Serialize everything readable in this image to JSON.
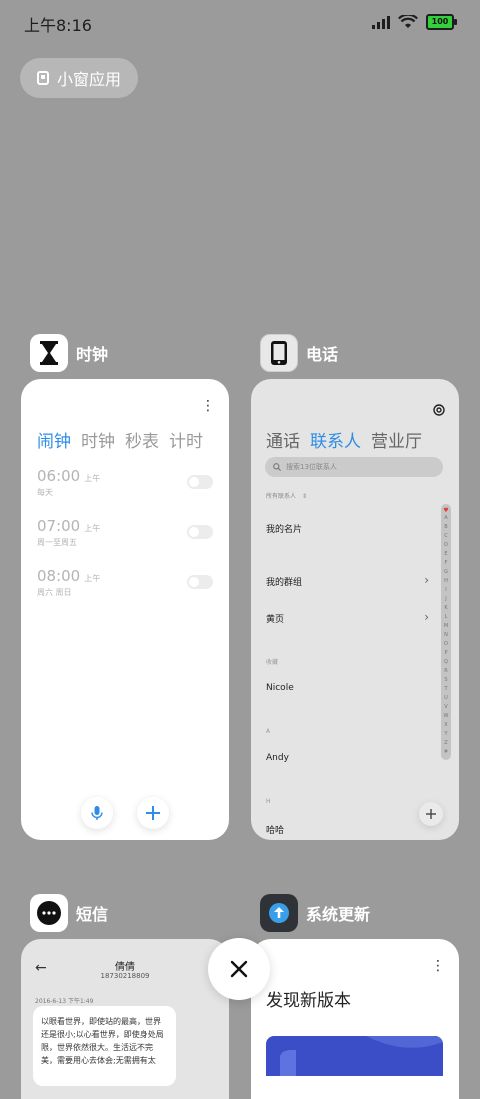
{
  "status_bar": {
    "time": "上午8:16",
    "battery": "100"
  },
  "floating_window_button": {
    "label": "小窗应用"
  },
  "apps": {
    "clock": {
      "name": "时钟",
      "tabs": [
        "闹钟",
        "时钟",
        "秒表",
        "计时"
      ],
      "alarms": [
        {
          "time": "06:00",
          "ampm": "上午",
          "repeat": "每天"
        },
        {
          "time": "07:00",
          "ampm": "上午",
          "repeat": "周一至周五"
        },
        {
          "time": "08:00",
          "ampm": "上午",
          "repeat": "周六 周日"
        }
      ]
    },
    "phone": {
      "name": "电话",
      "tabs": [
        "通话",
        "联系人",
        "营业厅"
      ],
      "search_placeholder": "搜索13位联系人",
      "filter_label": "所有联系人",
      "my_card": "我的名片",
      "my_groups": "我的群组",
      "yellow_pages": "黄页",
      "favorites_label": "收藏",
      "contacts": [
        {
          "section": "",
          "name": "Nicole"
        },
        {
          "section": "A",
          "name": "Andy"
        },
        {
          "section": "H",
          "name": "哈哈"
        }
      ],
      "index_letters": [
        "A",
        "B",
        "C",
        "D",
        "E",
        "F",
        "G",
        "H",
        "I",
        "J",
        "K",
        "L",
        "M",
        "N",
        "O",
        "P",
        "Q",
        "R",
        "S",
        "T",
        "U",
        "V",
        "W",
        "X",
        "Y",
        "Z",
        "#"
      ]
    },
    "messages": {
      "name": "短信",
      "contact_name": "倩倩",
      "contact_number": "18730218809",
      "date": "2016-6-13 下午1:49",
      "message_text": "以眼看世界，即使站的最高，世界还是很小;以心看世界，即使身处局限，世界依然很大。生活远不完美，需要用心去体会;无需拥有太"
    },
    "updater": {
      "name": "系统更新",
      "title": "发现新版本"
    }
  },
  "colors": {
    "accent": "#2f8de6",
    "background": "#9b9b9b"
  }
}
